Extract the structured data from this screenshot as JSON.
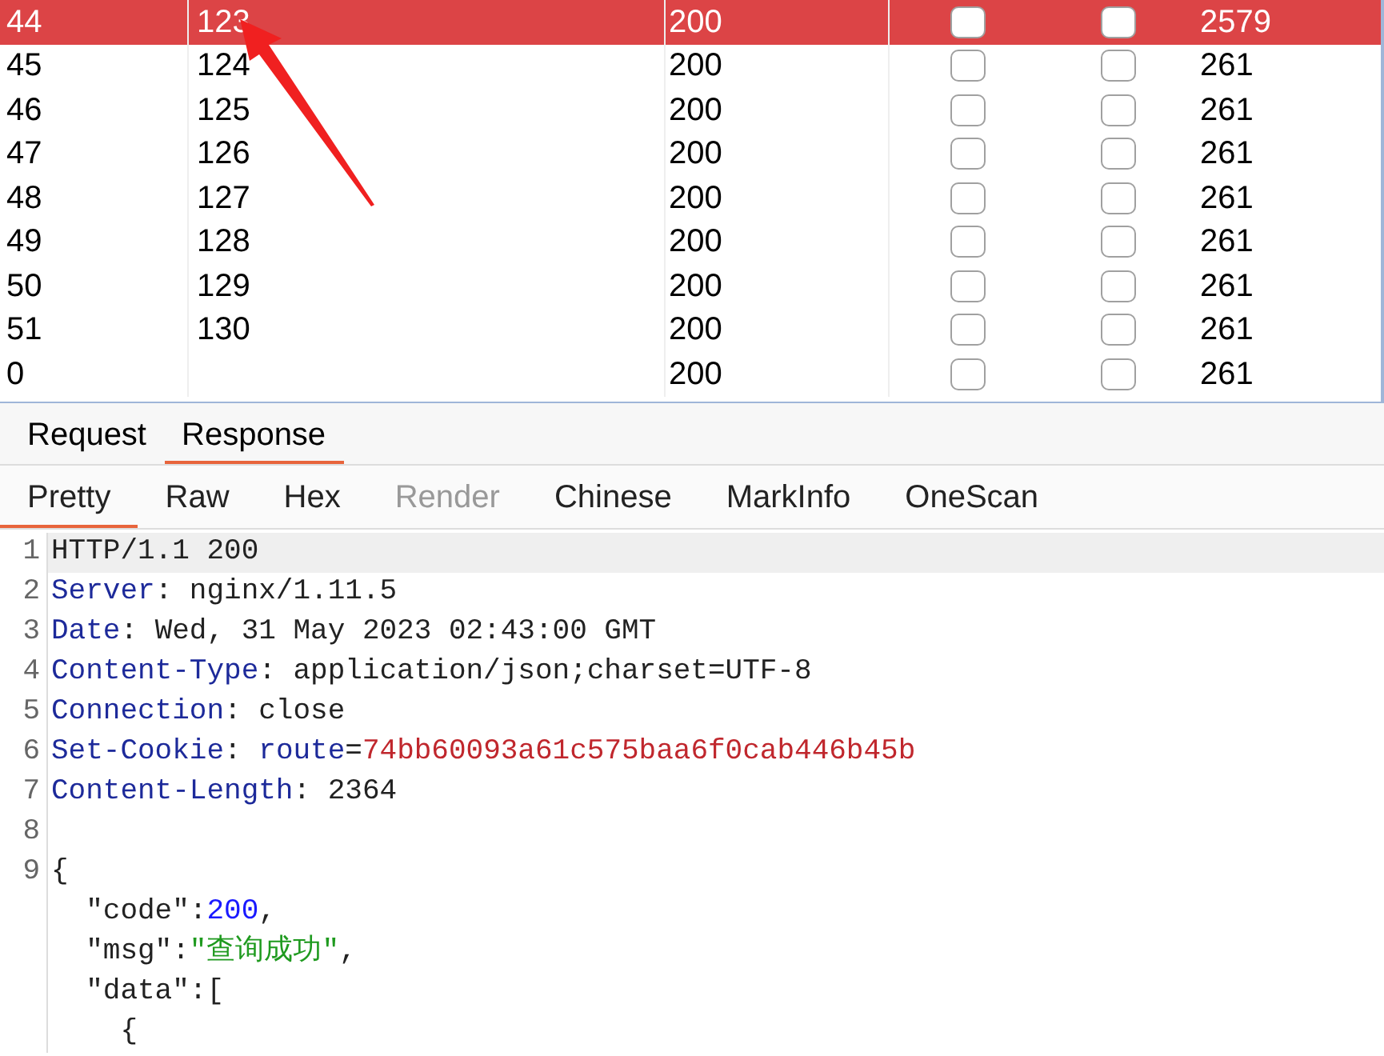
{
  "table": {
    "rows": [
      {
        "column_1": "44",
        "column_2": "123",
        "column_3": "200",
        "column_4_checked": false,
        "column_5_checked": false,
        "column_6": "2579",
        "selected": true
      },
      {
        "column_1": "45",
        "column_2": "124",
        "column_3": "200",
        "column_4_checked": false,
        "column_5_checked": false,
        "column_6": "261",
        "selected": false
      },
      {
        "column_1": "46",
        "column_2": "125",
        "column_3": "200",
        "column_4_checked": false,
        "column_5_checked": false,
        "column_6": "261",
        "selected": false
      },
      {
        "column_1": "47",
        "column_2": "126",
        "column_3": "200",
        "column_4_checked": false,
        "column_5_checked": false,
        "column_6": "261",
        "selected": false
      },
      {
        "column_1": "48",
        "column_2": "127",
        "column_3": "200",
        "column_4_checked": false,
        "column_5_checked": false,
        "column_6": "261",
        "selected": false
      },
      {
        "column_1": "49",
        "column_2": "128",
        "column_3": "200",
        "column_4_checked": false,
        "column_5_checked": false,
        "column_6": "261",
        "selected": false
      },
      {
        "column_1": "50",
        "column_2": "129",
        "column_3": "200",
        "column_4_checked": false,
        "column_5_checked": false,
        "column_6": "261",
        "selected": false
      },
      {
        "column_1": "51",
        "column_2": "130",
        "column_3": "200",
        "column_4_checked": false,
        "column_5_checked": false,
        "column_6": "261",
        "selected": false
      },
      {
        "column_1": "0",
        "column_3": "200",
        "column_4_checked": false,
        "column_5_checked": false,
        "column_6": "261",
        "selected": false
      }
    ]
  },
  "message_tabs": [
    {
      "label": "Request",
      "selected": false
    },
    {
      "label": "Response",
      "selected": true
    }
  ],
  "view_tabs": [
    {
      "label": "Pretty",
      "selected": true,
      "disabled": false
    },
    {
      "label": "Raw",
      "selected": false,
      "disabled": false
    },
    {
      "label": "Hex",
      "selected": false,
      "disabled": false
    },
    {
      "label": "Render",
      "selected": false,
      "disabled": true
    },
    {
      "label": "Chinese",
      "selected": false,
      "disabled": false
    },
    {
      "label": "MarkInfo",
      "selected": false,
      "disabled": false
    },
    {
      "label": "OneScan",
      "selected": false,
      "disabled": false
    }
  ],
  "code_lines": [
    {
      "number": "1",
      "highlighted": true,
      "parts": [
        {
          "kind": "plain",
          "text": "HTTP/1.1 200"
        }
      ]
    },
    {
      "number": "2",
      "highlighted": false,
      "parts": [
        {
          "kind": "header",
          "text": "Server"
        },
        {
          "kind": "plain",
          "text": ": nginx/1.11.5"
        }
      ]
    },
    {
      "number": "3",
      "highlighted": false,
      "parts": [
        {
          "kind": "header",
          "text": "Date"
        },
        {
          "kind": "plain",
          "text": ": Wed, 31 May 2023 02:43:00 GMT"
        }
      ]
    },
    {
      "number": "4",
      "highlighted": false,
      "parts": [
        {
          "kind": "header",
          "text": "Content-Type"
        },
        {
          "kind": "plain",
          "text": ": application/json;charset=UTF-8"
        }
      ]
    },
    {
      "number": "5",
      "highlighted": false,
      "parts": [
        {
          "kind": "header",
          "text": "Connection"
        },
        {
          "kind": "plain",
          "text": ": close"
        }
      ]
    },
    {
      "number": "6",
      "highlighted": false,
      "parts": [
        {
          "kind": "header",
          "text": "Set-Cookie"
        },
        {
          "kind": "plain",
          "text": ": "
        },
        {
          "kind": "header",
          "text": "route"
        },
        {
          "kind": "plain",
          "text": "="
        },
        {
          "kind": "cookie",
          "text": "74bb60093a61c575baa6f0cab446b45b"
        }
      ]
    },
    {
      "number": "7",
      "highlighted": false,
      "parts": [
        {
          "kind": "header",
          "text": "Content-Length"
        },
        {
          "kind": "plain",
          "text": ": 2364"
        }
      ]
    },
    {
      "number": "8",
      "highlighted": false
    },
    {
      "number": "9",
      "highlighted": false,
      "parts": [
        {
          "kind": "plain",
          "text": "{"
        }
      ]
    },
    {
      "highlighted": false,
      "parts": [
        {
          "kind": "plain",
          "text": "  \"code\":"
        },
        {
          "kind": "number",
          "text": "200"
        },
        {
          "kind": "plain",
          "text": ","
        }
      ]
    },
    {
      "highlighted": false,
      "parts": [
        {
          "kind": "plain",
          "text": "  \"msg\":"
        },
        {
          "kind": "string",
          "text": "\"查询成功\""
        },
        {
          "kind": "plain",
          "text": ","
        }
      ]
    },
    {
      "highlighted": false,
      "parts": [
        {
          "kind": "plain",
          "text": "  \"data\":["
        }
      ]
    },
    {
      "highlighted": false,
      "parts": [
        {
          "kind": "plain",
          "text": "    {"
        }
      ]
    }
  ]
}
